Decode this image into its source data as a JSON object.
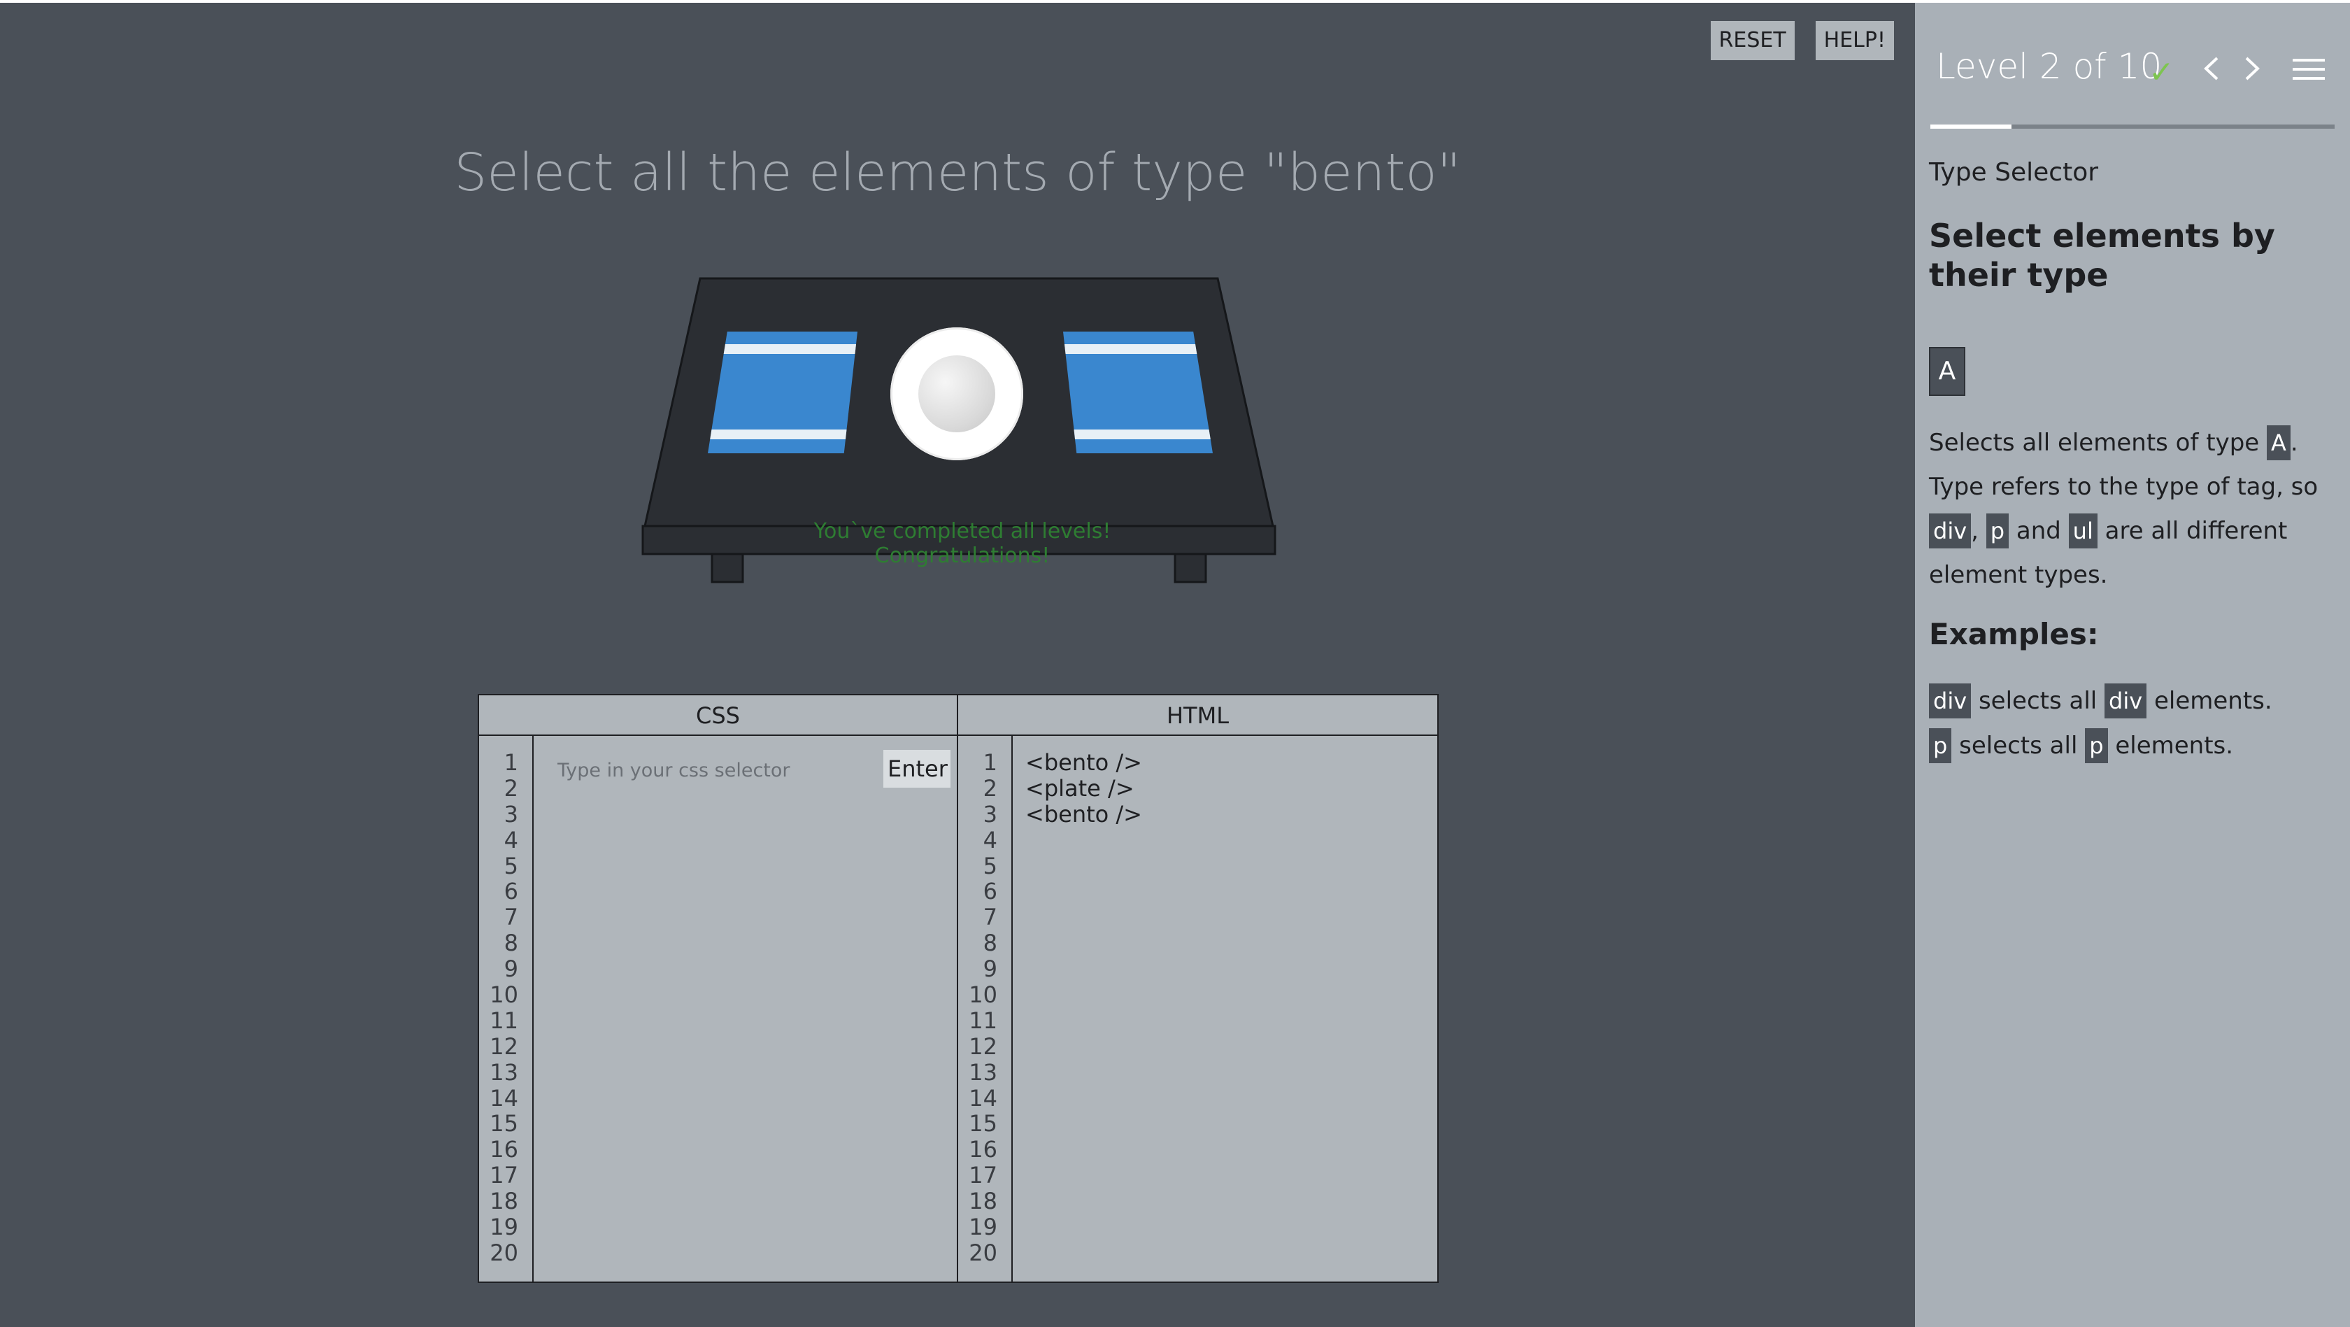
{
  "header": {
    "reset_label": "RESET",
    "help_label": "HELP!"
  },
  "game": {
    "instruction": "Select all the elements of type \"bento\"",
    "congrats": "You`ve completed all levels! Congratulations!"
  },
  "editor": {
    "css_title": "CSS",
    "html_title": "HTML",
    "input_placeholder": "Type in your css selector",
    "enter_label": "Enter",
    "line_numbers": [
      "1",
      "2",
      "3",
      "4",
      "5",
      "6",
      "7",
      "8",
      "9",
      "10",
      "11",
      "12",
      "13",
      "14",
      "15",
      "16",
      "17",
      "18",
      "19",
      "20"
    ],
    "html_lines": [
      "<bento />",
      "<plate />",
      "<bento />"
    ]
  },
  "sidebar": {
    "level_text": "Level 2 of 10",
    "progress": 0.2,
    "selector_name": "Type Selector",
    "title": "Select elements by their type",
    "syntax": "A",
    "hint": {
      "part1": "Selects all elements of type ",
      "tag_a": "A",
      "part2": ". Type refers to the type of tag, so ",
      "tag_div": "div",
      "comma": ", ",
      "tag_p": "p",
      "part3": " and ",
      "tag_ul": "ul",
      "part4": " are all different element types."
    },
    "examples_title": "Examples:",
    "examples": [
      {
        "tag1": "div",
        "mid": " selects all ",
        "tag2": "div",
        "end": " elements."
      },
      {
        "tag1": "p",
        "mid": " selects all ",
        "tag2": "p",
        "end": " elements."
      }
    ]
  },
  "colors": {
    "game_bg": "#4a5058",
    "sidebar_bg": "#a9b0b7",
    "editor_bg": "#b0b6bb",
    "bento_blue": "#3a87cf",
    "check_green": "#7dc54f",
    "congrats_green": "#2e7d32"
  },
  "icons": {
    "check": "check-icon",
    "prev": "chevron-left-icon",
    "next": "chevron-right-icon",
    "menu": "hamburger-menu-icon"
  }
}
